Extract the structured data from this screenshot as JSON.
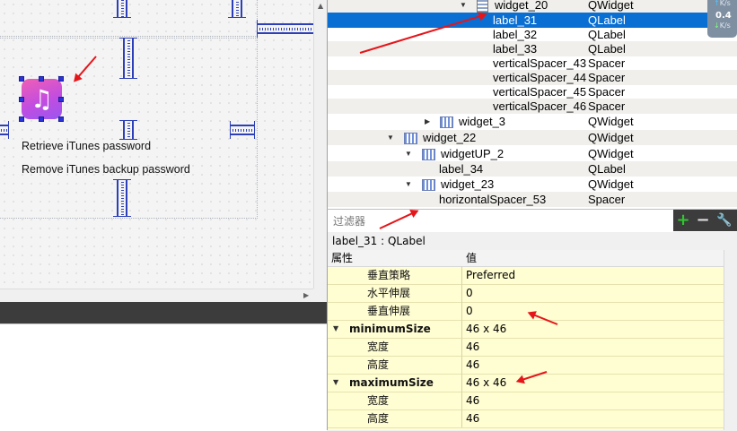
{
  "object_tree": {
    "rows": [
      {
        "name": "widget_20",
        "type": "QWidget"
      },
      {
        "name": "label_31",
        "type": "QLabel"
      },
      {
        "name": "label_32",
        "type": "QLabel"
      },
      {
        "name": "label_33",
        "type": "QLabel"
      },
      {
        "name": "verticalSpacer_43",
        "type": "Spacer"
      },
      {
        "name": "verticalSpacer_44",
        "type": "Spacer"
      },
      {
        "name": "verticalSpacer_45",
        "type": "Spacer"
      },
      {
        "name": "verticalSpacer_46",
        "type": "Spacer"
      },
      {
        "name": "widget_3",
        "type": "QWidget"
      },
      {
        "name": "widget_22",
        "type": "QWidget"
      },
      {
        "name": "widgetUP_2",
        "type": "QWidget"
      },
      {
        "name": "label_34",
        "type": "QLabel"
      },
      {
        "name": "widget_23",
        "type": "QWidget"
      },
      {
        "name": "horizontalSpacer_53",
        "type": "Spacer"
      }
    ],
    "selected": "label_31"
  },
  "net_speed": {
    "upload": "K/s",
    "value": "0.4",
    "download": "K/s"
  },
  "canvas": {
    "label_retrieve": "Retrieve iTunes password",
    "label_remove": "Remove iTunes backup password",
    "icon": "music-note-icon"
  },
  "filter": {
    "placeholder": "过滤器"
  },
  "property_editor": {
    "object_label": "label_31 : QLabel",
    "header_property": "属性",
    "header_value": "值",
    "rows": [
      {
        "name": "垂直策略",
        "value": "Preferred",
        "group": false
      },
      {
        "name": "水平伸展",
        "value": "0",
        "group": false
      },
      {
        "name": "垂直伸展",
        "value": "0",
        "group": false
      },
      {
        "name": "minimumSize",
        "value": "46 x 46",
        "group": true
      },
      {
        "name": "宽度",
        "value": "46",
        "group": false
      },
      {
        "name": "高度",
        "value": "46",
        "group": false
      },
      {
        "name": "maximumSize",
        "value": "46 x 46",
        "group": true
      },
      {
        "name": "宽度",
        "value": "46",
        "group": false
      },
      {
        "name": "高度",
        "value": "46",
        "group": false
      }
    ]
  },
  "colors": {
    "selection": "#0a6fd3",
    "annotation_arrow": "#e5151a",
    "property_bg": "#fffdd2",
    "app_icon_gradient": [
      "#f05fb4",
      "#9a56f0"
    ]
  }
}
